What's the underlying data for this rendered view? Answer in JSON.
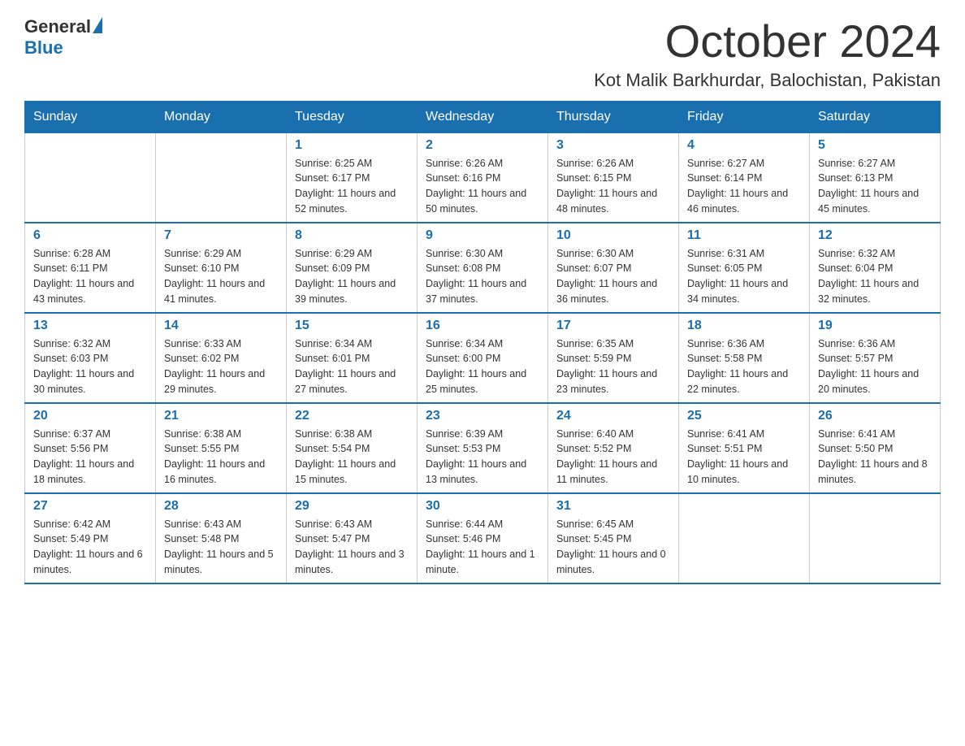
{
  "logo": {
    "general": "General",
    "blue": "Blue"
  },
  "header": {
    "month": "October 2024",
    "location": "Kot Malik Barkhurdar, Balochistan, Pakistan"
  },
  "days_of_week": [
    "Sunday",
    "Monday",
    "Tuesday",
    "Wednesday",
    "Thursday",
    "Friday",
    "Saturday"
  ],
  "weeks": [
    [
      {
        "day": "",
        "sunrise": "",
        "sunset": "",
        "daylight": ""
      },
      {
        "day": "",
        "sunrise": "",
        "sunset": "",
        "daylight": ""
      },
      {
        "day": "1",
        "sunrise": "Sunrise: 6:25 AM",
        "sunset": "Sunset: 6:17 PM",
        "daylight": "Daylight: 11 hours and 52 minutes."
      },
      {
        "day": "2",
        "sunrise": "Sunrise: 6:26 AM",
        "sunset": "Sunset: 6:16 PM",
        "daylight": "Daylight: 11 hours and 50 minutes."
      },
      {
        "day": "3",
        "sunrise": "Sunrise: 6:26 AM",
        "sunset": "Sunset: 6:15 PM",
        "daylight": "Daylight: 11 hours and 48 minutes."
      },
      {
        "day": "4",
        "sunrise": "Sunrise: 6:27 AM",
        "sunset": "Sunset: 6:14 PM",
        "daylight": "Daylight: 11 hours and 46 minutes."
      },
      {
        "day": "5",
        "sunrise": "Sunrise: 6:27 AM",
        "sunset": "Sunset: 6:13 PM",
        "daylight": "Daylight: 11 hours and 45 minutes."
      }
    ],
    [
      {
        "day": "6",
        "sunrise": "Sunrise: 6:28 AM",
        "sunset": "Sunset: 6:11 PM",
        "daylight": "Daylight: 11 hours and 43 minutes."
      },
      {
        "day": "7",
        "sunrise": "Sunrise: 6:29 AM",
        "sunset": "Sunset: 6:10 PM",
        "daylight": "Daylight: 11 hours and 41 minutes."
      },
      {
        "day": "8",
        "sunrise": "Sunrise: 6:29 AM",
        "sunset": "Sunset: 6:09 PM",
        "daylight": "Daylight: 11 hours and 39 minutes."
      },
      {
        "day": "9",
        "sunrise": "Sunrise: 6:30 AM",
        "sunset": "Sunset: 6:08 PM",
        "daylight": "Daylight: 11 hours and 37 minutes."
      },
      {
        "day": "10",
        "sunrise": "Sunrise: 6:30 AM",
        "sunset": "Sunset: 6:07 PM",
        "daylight": "Daylight: 11 hours and 36 minutes."
      },
      {
        "day": "11",
        "sunrise": "Sunrise: 6:31 AM",
        "sunset": "Sunset: 6:05 PM",
        "daylight": "Daylight: 11 hours and 34 minutes."
      },
      {
        "day": "12",
        "sunrise": "Sunrise: 6:32 AM",
        "sunset": "Sunset: 6:04 PM",
        "daylight": "Daylight: 11 hours and 32 minutes."
      }
    ],
    [
      {
        "day": "13",
        "sunrise": "Sunrise: 6:32 AM",
        "sunset": "Sunset: 6:03 PM",
        "daylight": "Daylight: 11 hours and 30 minutes."
      },
      {
        "day": "14",
        "sunrise": "Sunrise: 6:33 AM",
        "sunset": "Sunset: 6:02 PM",
        "daylight": "Daylight: 11 hours and 29 minutes."
      },
      {
        "day": "15",
        "sunrise": "Sunrise: 6:34 AM",
        "sunset": "Sunset: 6:01 PM",
        "daylight": "Daylight: 11 hours and 27 minutes."
      },
      {
        "day": "16",
        "sunrise": "Sunrise: 6:34 AM",
        "sunset": "Sunset: 6:00 PM",
        "daylight": "Daylight: 11 hours and 25 minutes."
      },
      {
        "day": "17",
        "sunrise": "Sunrise: 6:35 AM",
        "sunset": "Sunset: 5:59 PM",
        "daylight": "Daylight: 11 hours and 23 minutes."
      },
      {
        "day": "18",
        "sunrise": "Sunrise: 6:36 AM",
        "sunset": "Sunset: 5:58 PM",
        "daylight": "Daylight: 11 hours and 22 minutes."
      },
      {
        "day": "19",
        "sunrise": "Sunrise: 6:36 AM",
        "sunset": "Sunset: 5:57 PM",
        "daylight": "Daylight: 11 hours and 20 minutes."
      }
    ],
    [
      {
        "day": "20",
        "sunrise": "Sunrise: 6:37 AM",
        "sunset": "Sunset: 5:56 PM",
        "daylight": "Daylight: 11 hours and 18 minutes."
      },
      {
        "day": "21",
        "sunrise": "Sunrise: 6:38 AM",
        "sunset": "Sunset: 5:55 PM",
        "daylight": "Daylight: 11 hours and 16 minutes."
      },
      {
        "day": "22",
        "sunrise": "Sunrise: 6:38 AM",
        "sunset": "Sunset: 5:54 PM",
        "daylight": "Daylight: 11 hours and 15 minutes."
      },
      {
        "day": "23",
        "sunrise": "Sunrise: 6:39 AM",
        "sunset": "Sunset: 5:53 PM",
        "daylight": "Daylight: 11 hours and 13 minutes."
      },
      {
        "day": "24",
        "sunrise": "Sunrise: 6:40 AM",
        "sunset": "Sunset: 5:52 PM",
        "daylight": "Daylight: 11 hours and 11 minutes."
      },
      {
        "day": "25",
        "sunrise": "Sunrise: 6:41 AM",
        "sunset": "Sunset: 5:51 PM",
        "daylight": "Daylight: 11 hours and 10 minutes."
      },
      {
        "day": "26",
        "sunrise": "Sunrise: 6:41 AM",
        "sunset": "Sunset: 5:50 PM",
        "daylight": "Daylight: 11 hours and 8 minutes."
      }
    ],
    [
      {
        "day": "27",
        "sunrise": "Sunrise: 6:42 AM",
        "sunset": "Sunset: 5:49 PM",
        "daylight": "Daylight: 11 hours and 6 minutes."
      },
      {
        "day": "28",
        "sunrise": "Sunrise: 6:43 AM",
        "sunset": "Sunset: 5:48 PM",
        "daylight": "Daylight: 11 hours and 5 minutes."
      },
      {
        "day": "29",
        "sunrise": "Sunrise: 6:43 AM",
        "sunset": "Sunset: 5:47 PM",
        "daylight": "Daylight: 11 hours and 3 minutes."
      },
      {
        "day": "30",
        "sunrise": "Sunrise: 6:44 AM",
        "sunset": "Sunset: 5:46 PM",
        "daylight": "Daylight: 11 hours and 1 minute."
      },
      {
        "day": "31",
        "sunrise": "Sunrise: 6:45 AM",
        "sunset": "Sunset: 5:45 PM",
        "daylight": "Daylight: 11 hours and 0 minutes."
      },
      {
        "day": "",
        "sunrise": "",
        "sunset": "",
        "daylight": ""
      },
      {
        "day": "",
        "sunrise": "",
        "sunset": "",
        "daylight": ""
      }
    ]
  ]
}
